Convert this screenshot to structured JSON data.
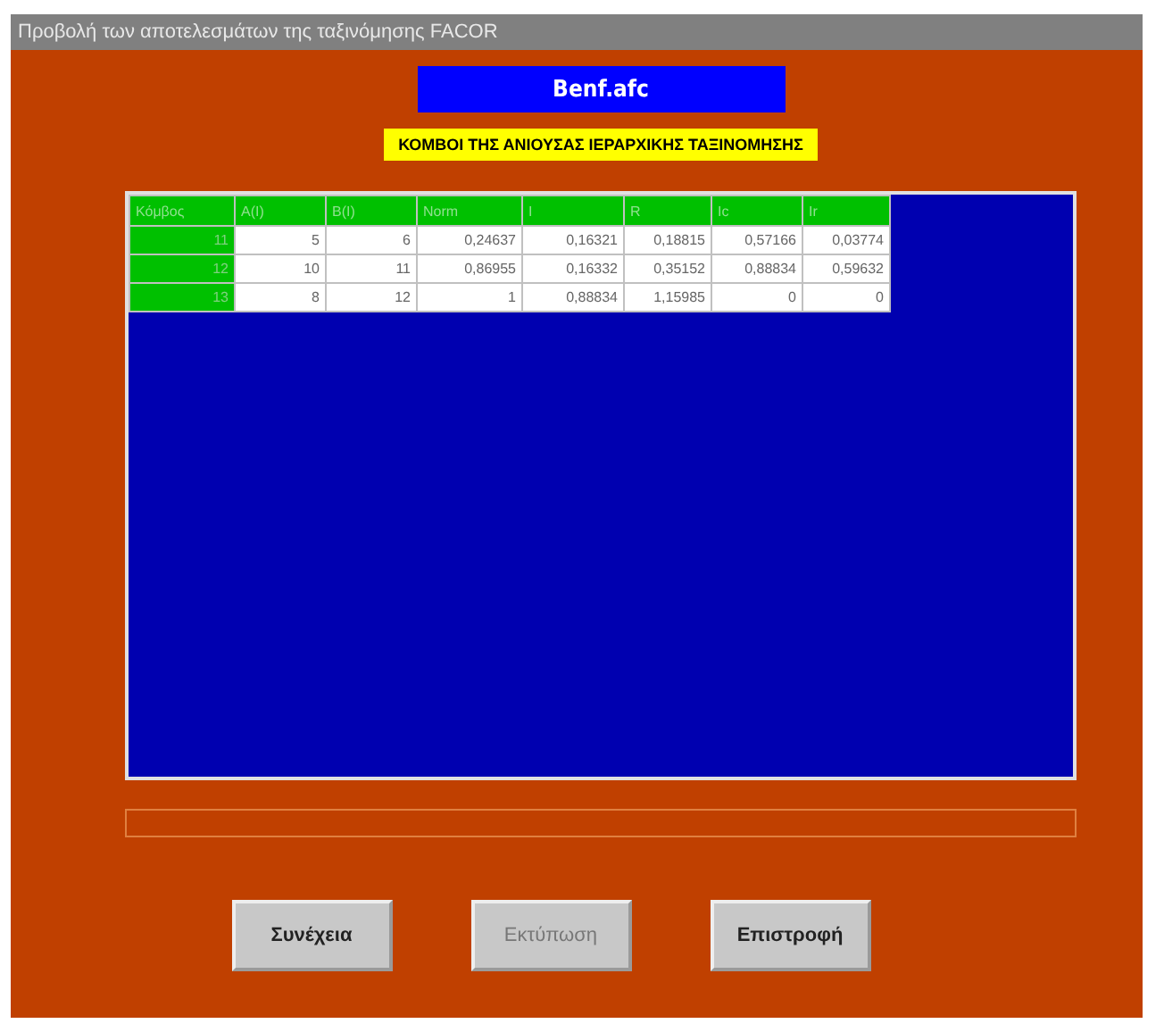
{
  "window": {
    "title": "Προβολή των αποτελεσμάτων της ταξινόμησης FACOR"
  },
  "file_name": "Benf.afc",
  "heading": "ΚΟΜΒΟΙ ΤΗΣ ΑΝΙΟΥΣΑΣ ΙΕΡΑΡΧΙΚΗΣ ΤΑΞΙΝΟΜΗΣΗΣ",
  "table": {
    "columns": [
      "Κόμβος",
      "A(I)",
      "B(I)",
      "Norm",
      "I",
      "R",
      "Ic",
      "Ir"
    ],
    "rows": [
      [
        "11",
        "5",
        "6",
        "0,24637",
        "0,16321",
        "0,18815",
        "0,57166",
        "0,03774"
      ],
      [
        "12",
        "10",
        "11",
        "0,86955",
        "0,16332",
        "0,35152",
        "0,88834",
        "0,59632"
      ],
      [
        "13",
        "8",
        "12",
        "1",
        "0,88834",
        "1,15985",
        "0",
        "0"
      ]
    ]
  },
  "progress": {
    "level": 0
  },
  "buttons": [
    {
      "label": "Συνέχεια",
      "disabled": false
    },
    {
      "label": "Εκτύπωση",
      "disabled": true
    },
    {
      "label": "Επιστροφή",
      "disabled": false
    }
  ]
}
